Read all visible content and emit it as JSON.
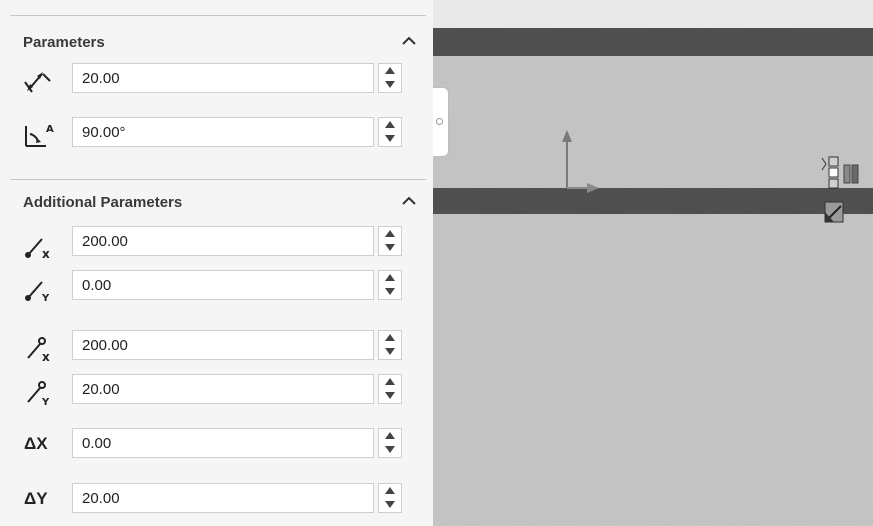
{
  "parameters": {
    "title": "Parameters",
    "distance_value": "20.00",
    "angle_value": "90.00°"
  },
  "additional_parameters": {
    "title": "Additional Parameters",
    "start_x_value": "200.00",
    "start_y_value": "0.00",
    "end_x_value": "200.00",
    "end_y_value": "20.00",
    "delta_x_label": "ΔX",
    "delta_x_value": "0.00",
    "delta_y_label": "ΔY",
    "delta_y_value": "20.00"
  },
  "icons": {
    "distance": "linear-distance-icon",
    "angle": "angle-icon",
    "start_x": "start-point-x-icon",
    "start_y": "start-point-y-icon",
    "end_x": "end-point-x-icon",
    "end_y": "end-point-y-icon",
    "collapse": "chevron-up-icon",
    "spin_up": "spin-up-icon",
    "spin_down": "spin-down-icon"
  },
  "colors": {
    "panel_background": "#f5f5f5",
    "graphics_background": "#c4c4c4",
    "beam": "#505050"
  }
}
